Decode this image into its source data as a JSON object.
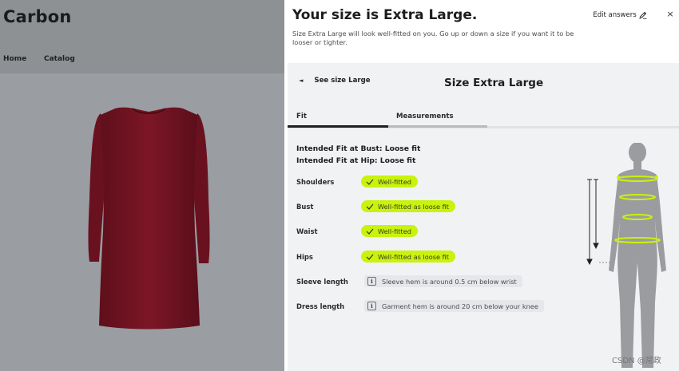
{
  "store": {
    "brand": "Carbon",
    "nav": [
      "Home",
      "Catalog"
    ]
  },
  "panel": {
    "title": "Your size is Extra Large.",
    "subtitle": "Size Extra Large will look well-fitted on you. Go up or down a size if you want it to be looser or tighter.",
    "edit_label": "Edit answers",
    "close_label": "×",
    "back_label": "See size Large",
    "back_chevron": "◄",
    "size_heading": "Size Extra Large",
    "tabs": [
      "Fit",
      "Measurements"
    ],
    "active_tab": "Fit",
    "intended_bust": "Intended Fit at Bust: Loose fit",
    "intended_hip": "Intended Fit at Hip: Loose fit",
    "rows": [
      {
        "label": "Shoulders",
        "value": "Well-fitted",
        "kind": "fit"
      },
      {
        "label": "Bust",
        "value": "Well-fitted as loose fit",
        "kind": "fit"
      },
      {
        "label": "Waist",
        "value": "Well-fitted",
        "kind": "fit"
      },
      {
        "label": "Hips",
        "value": "Well-fitted as loose fit",
        "kind": "fit"
      },
      {
        "label": "Sleeve length",
        "value": "Sleeve hem is around 0.5 cm below wrist",
        "kind": "info"
      },
      {
        "label": "Dress length",
        "value": "Garment hem is around 20 cm below your knee",
        "kind": "info"
      }
    ],
    "info_glyph": "i"
  },
  "watermark": "CSDN @常政",
  "colors": {
    "accent_pill": "#c9f20d",
    "dress": "#7a1424",
    "overlay": "#8f9296"
  }
}
